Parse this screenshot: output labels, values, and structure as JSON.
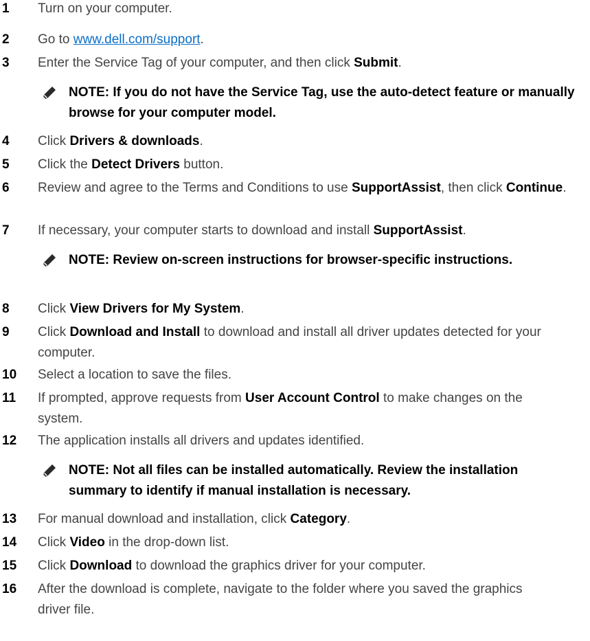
{
  "steps": [
    {
      "num": "1",
      "parts": [
        {
          "t": "Turn on your computer."
        }
      ]
    },
    {
      "num": "2",
      "parts": [
        {
          "t": "Go to "
        },
        {
          "t": "www.dell.com/support",
          "link": true
        },
        {
          "t": "."
        }
      ]
    },
    {
      "num": "3",
      "parts": [
        {
          "t": "Enter the Service Tag of your computer, and then click "
        },
        {
          "t": "Submit",
          "b": true
        },
        {
          "t": "."
        }
      ]
    },
    {
      "num": "4",
      "parts": [
        {
          "t": "Click "
        },
        {
          "t": "Drivers & downloads",
          "b": true
        },
        {
          "t": "."
        }
      ]
    },
    {
      "num": "5",
      "parts": [
        {
          "t": "Click the "
        },
        {
          "t": "Detect Drivers",
          "b": true
        },
        {
          "t": " button."
        }
      ]
    },
    {
      "num": "6",
      "parts": [
        {
          "t": "Review and agree to the Terms and Conditions to use "
        },
        {
          "t": "SupportAssist",
          "b": true
        },
        {
          "t": ", then click "
        },
        {
          "t": "Continue",
          "b": true
        },
        {
          "t": "."
        }
      ]
    },
    {
      "num": "7",
      "parts": [
        {
          "t": "If necessary, your computer starts to download and install "
        },
        {
          "t": "SupportAssist",
          "b": true
        },
        {
          "t": "."
        }
      ]
    },
    {
      "num": "8",
      "parts": [
        {
          "t": "Click "
        },
        {
          "t": "View Drivers for My System",
          "b": true
        },
        {
          "t": "."
        }
      ]
    },
    {
      "num": "9",
      "parts": [
        {
          "t": "Click "
        },
        {
          "t": "Download and Install",
          "b": true
        },
        {
          "t": " to download and install all driver updates detected for your computer."
        }
      ]
    },
    {
      "num": "10",
      "parts": [
        {
          "t": "Select a location to save the files."
        }
      ]
    },
    {
      "num": "11",
      "parts": [
        {
          "t": "If prompted, approve requests from "
        },
        {
          "t": "User Account Control",
          "b": true
        },
        {
          "t": " to make changes on the system."
        }
      ]
    },
    {
      "num": "12",
      "parts": [
        {
          "t": "The application installs all drivers and updates identified."
        }
      ]
    },
    {
      "num": "13",
      "parts": [
        {
          "t": "For manual download and installation, click "
        },
        {
          "t": "Category",
          "b": true
        },
        {
          "t": "."
        }
      ]
    },
    {
      "num": "14",
      "parts": [
        {
          "t": "Click "
        },
        {
          "t": "Video",
          "b": true
        },
        {
          "t": " in the drop-down list."
        }
      ]
    },
    {
      "num": "15",
      "parts": [
        {
          "t": "Click "
        },
        {
          "t": "Download",
          "b": true
        },
        {
          "t": " to download the graphics driver for your computer."
        }
      ]
    },
    {
      "num": "16",
      "parts": [
        {
          "t": "After the download is complete, navigate to the folder where you saved the graphics driver file."
        }
      ]
    }
  ],
  "notes": [
    {
      "icon": "note-pencil-icon",
      "text": "NOTE: If you do not have the Service Tag, use the auto-detect feature or manually browse for your computer model."
    },
    {
      "icon": "note-pencil-icon",
      "text": "NOTE: Review on-screen instructions for browser-specific instructions."
    },
    {
      "icon": "note-pencil-icon",
      "text": "NOTE: Not all files can be installed automatically. Review the installation summary to identify if manual installation is necessary."
    }
  ]
}
